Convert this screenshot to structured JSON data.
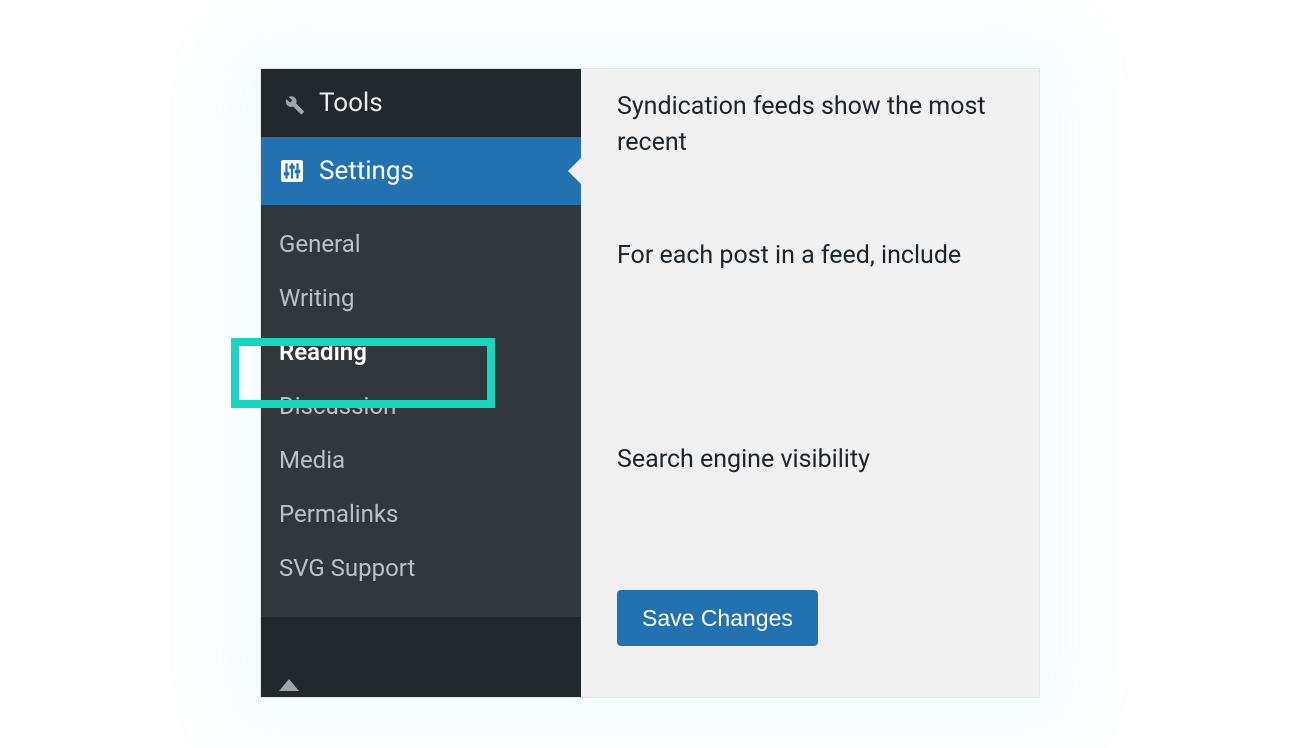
{
  "sidebar": {
    "tools": {
      "label": "Tools"
    },
    "settings": {
      "label": "Settings"
    },
    "submenu": [
      {
        "label": "General",
        "active": false
      },
      {
        "label": "Writing",
        "active": false
      },
      {
        "label": "Reading",
        "active": true
      },
      {
        "label": "Discussion",
        "active": false
      },
      {
        "label": "Media",
        "active": false
      },
      {
        "label": "Permalinks",
        "active": false
      },
      {
        "label": "SVG Support",
        "active": false
      }
    ]
  },
  "content": {
    "syndication_label": "Syndication feeds show the most recent",
    "feed_include_label": "For each post in a feed, include",
    "search_visibility_label": "Search engine visibility",
    "save_button": "Save Changes"
  }
}
